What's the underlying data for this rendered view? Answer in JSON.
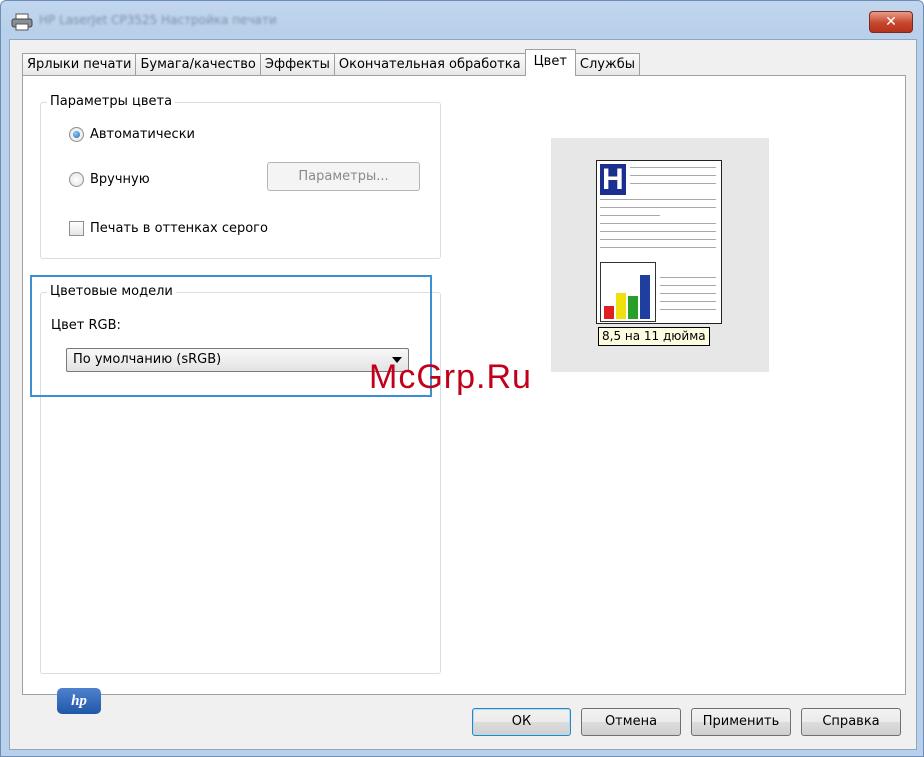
{
  "window": {
    "title": "HP LaserJet CP3525 Настройка печати",
    "close_label": "✕"
  },
  "tabs": [
    {
      "label": "Ярлыки печати"
    },
    {
      "label": "Бумага/качество"
    },
    {
      "label": "Эффекты"
    },
    {
      "label": "Окончательная обработка"
    },
    {
      "label": "Цвет",
      "active": true
    },
    {
      "label": "Службы"
    }
  ],
  "color_options": {
    "group_title": "Параметры цвета",
    "auto_label": "Автоматически",
    "manual_label": "Вручную",
    "settings_button": "Параметры...",
    "grayscale_label": "Печать в оттенках серого",
    "selected": "auto"
  },
  "color_models": {
    "group_title": "Цветовые модели",
    "rgb_label": "Цвет RGB:",
    "rgb_value": "По умолчанию (sRGB)"
  },
  "preview": {
    "header_letter": "H",
    "paper_size": "8,5 на 11 дюйма",
    "bar_colors": [
      "#e02020",
      "#f0e010",
      "#28a028",
      "#1f3fa0"
    ],
    "bar_levels": [
      0.25,
      0.5,
      0.45,
      0.85
    ]
  },
  "branding": {
    "logo_text": "hp"
  },
  "buttons": {
    "ok": "ОК",
    "cancel": "Отмена",
    "apply": "Применить",
    "help": "Справка"
  },
  "watermark": "McGrp.Ru",
  "colors": {
    "highlight": "#3c8fd0",
    "watermark": "#c1001a"
  }
}
